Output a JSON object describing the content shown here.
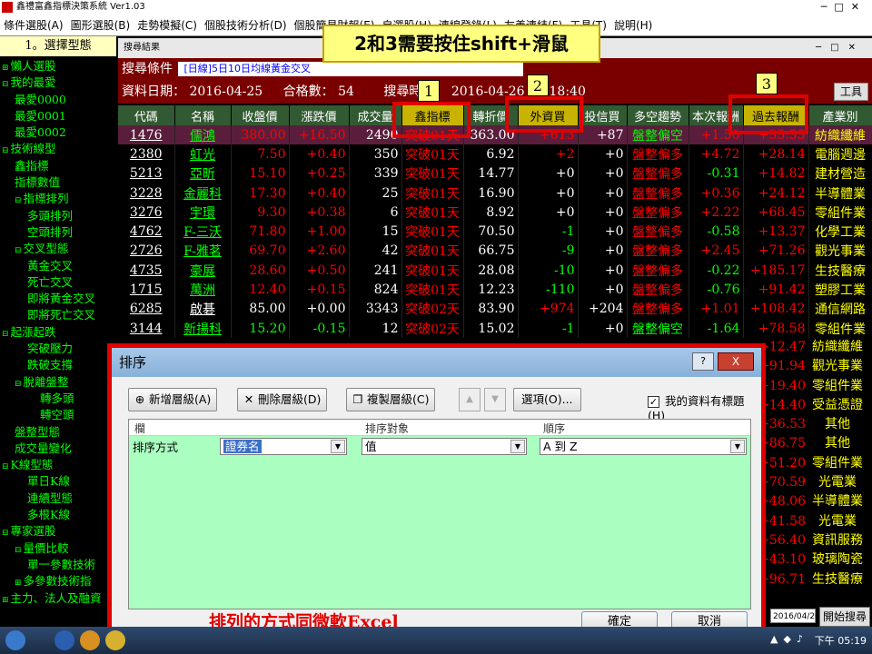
{
  "app": {
    "title": "鑫禮富鑫指標決策系統 Ver1.03",
    "inner_window_title": "搜尋結果"
  },
  "menu": [
    "條件選股(A)",
    "圖形選股(B)",
    "走勢模擬(C)",
    "個股技術分析(D)",
    "個股簡易財報(E)",
    "自選股(H)",
    "連線登錄(L)",
    "友善連結(F)",
    "工具(T)",
    "說明(H)"
  ],
  "sidebar": {
    "header": "1。選擇型態",
    "items": [
      {
        "level": 0,
        "label": "懶人選股",
        "toggle": "⊞"
      },
      {
        "level": 0,
        "label": "我的最愛",
        "toggle": "⊟"
      },
      {
        "level": 1,
        "label": "最愛0000",
        "toggle": ""
      },
      {
        "level": 1,
        "label": "最愛0001",
        "toggle": ""
      },
      {
        "level": 1,
        "label": "最愛0002",
        "toggle": ""
      },
      {
        "level": 0,
        "label": "技術線型",
        "toggle": "⊟"
      },
      {
        "level": 1,
        "label": "鑫指標",
        "toggle": ""
      },
      {
        "level": 1,
        "label": "指標數值",
        "toggle": ""
      },
      {
        "level": 1,
        "label": "指標排列",
        "toggle": "⊟"
      },
      {
        "level": 2,
        "label": "多頭排列",
        "toggle": ""
      },
      {
        "level": 2,
        "label": "空頭排列",
        "toggle": ""
      },
      {
        "level": 1,
        "label": "交叉型態",
        "toggle": "⊟"
      },
      {
        "level": 2,
        "label": "黃金交叉",
        "toggle": ""
      },
      {
        "level": 2,
        "label": "死亡交叉",
        "toggle": ""
      },
      {
        "level": 2,
        "label": "即將黃金交叉",
        "toggle": ""
      },
      {
        "level": 2,
        "label": "即將死亡交叉",
        "toggle": ""
      },
      {
        "level": 0,
        "label": "起漲起跌",
        "toggle": "⊟"
      },
      {
        "level": 2,
        "label": "突破壓力",
        "toggle": ""
      },
      {
        "level": 2,
        "label": "跌破支撐",
        "toggle": ""
      },
      {
        "level": 1,
        "label": "脫離盤整",
        "toggle": "⊟"
      },
      {
        "level": 3,
        "label": "轉多頭",
        "toggle": ""
      },
      {
        "level": 3,
        "label": "轉空頭",
        "toggle": ""
      },
      {
        "level": 1,
        "label": "盤整型態",
        "toggle": ""
      },
      {
        "level": 1,
        "label": "成交量變化",
        "toggle": ""
      },
      {
        "level": 0,
        "label": "K線型態",
        "toggle": "⊟"
      },
      {
        "level": 2,
        "label": "單日K線",
        "toggle": ""
      },
      {
        "level": 2,
        "label": "連續型態",
        "toggle": ""
      },
      {
        "level": 2,
        "label": "多根K線",
        "toggle": ""
      },
      {
        "level": 0,
        "label": "專家選股",
        "toggle": "⊟"
      },
      {
        "level": 1,
        "label": "量價比較",
        "toggle": "⊟"
      },
      {
        "level": 2,
        "label": "單一參數技術",
        "toggle": ""
      },
      {
        "level": 1,
        "label": "多參數技術指",
        "toggle": "⊞"
      },
      {
        "level": 0,
        "label": "主力、法人及融資",
        "toggle": "⊞"
      }
    ]
  },
  "search": {
    "label": "搜尋條件",
    "condition": "[日線]5日10日均線黃金交叉",
    "date_label": "資料日期：",
    "date_value": "2016-04-25",
    "count_label": "合格數：",
    "count_value": "54",
    "time_label": "搜尋時間：",
    "time_value": "2016-04-26 17:18:40",
    "tools": "工具"
  },
  "table": {
    "headers": [
      "代碼",
      "名稱",
      "收盤價",
      "漲跌價",
      "成交量",
      "鑫指標",
      "轉折價",
      "外資買",
      "投信買",
      "多空趨勢",
      "本次報酬",
      "過去報酬",
      "產業別"
    ],
    "rows": [
      [
        "1476",
        "儒鴻",
        "380.00",
        "+16.50",
        "2490",
        "突破01天",
        "363.00",
        "+613",
        "+87",
        "盤整偏空",
        "+1.50",
        "+35.55",
        "紡織纖維"
      ],
      [
        "2380",
        "虹光",
        "7.50",
        "+0.40",
        "350",
        "突破01天",
        "6.92",
        "+2",
        "+0",
        "盤整偏多",
        "+4.72",
        "+28.14",
        "電腦週邊"
      ],
      [
        "5213",
        "亞昕",
        "15.10",
        "+0.25",
        "339",
        "突破01天",
        "14.77",
        "+0",
        "+0",
        "盤整偏多",
        "-0.31",
        "+14.82",
        "建材營造"
      ],
      [
        "3228",
        "金麗科",
        "17.30",
        "+0.40",
        "25",
        "突破01天",
        "16.90",
        "+0",
        "+0",
        "盤整偏多",
        "+0.36",
        "+24.12",
        "半導體業"
      ],
      [
        "3276",
        "宇環",
        "9.30",
        "+0.38",
        "6",
        "突破01天",
        "8.92",
        "+0",
        "+0",
        "盤整偏多",
        "+2.22",
        "+68.45",
        "零組件業"
      ],
      [
        "4762",
        "F-三沃",
        "71.80",
        "+1.00",
        "15",
        "突破01天",
        "70.50",
        "-1",
        "+0",
        "盤整偏多",
        "-0.58",
        "+13.37",
        "化學工業"
      ],
      [
        "2726",
        "F-雅茗",
        "69.70",
        "+2.60",
        "42",
        "突破01天",
        "66.75",
        "-9",
        "+0",
        "盤整偏多",
        "+2.45",
        "+71.26",
        "觀光事業"
      ],
      [
        "4735",
        "豪展",
        "28.60",
        "+0.50",
        "241",
        "突破01天",
        "28.08",
        "-10",
        "+0",
        "盤整偏多",
        "-0.22",
        "+185.17",
        "生技醫療"
      ],
      [
        "1715",
        "萬洲",
        "12.40",
        "+0.15",
        "824",
        "突破01天",
        "12.23",
        "-110",
        "+0",
        "盤整偏多",
        "-0.76",
        "+91.42",
        "塑膠工業"
      ],
      [
        "6285",
        "啟碁",
        "85.00",
        "+0.00",
        "3343",
        "突破02天",
        "83.90",
        "+974",
        "+204",
        "盤整偏多",
        "+1.01",
        "+108.42",
        "通信網路"
      ],
      [
        "3144",
        "新揚科",
        "15.20",
        "-0.15",
        "12",
        "突破02天",
        "15.02",
        "-1",
        "+0",
        "盤整偏空",
        "-1.64",
        "+78.58",
        "零組件業"
      ]
    ],
    "hidden_tail": [
      [
        "+12.47",
        "紡織纖維"
      ],
      [
        "+91.94",
        "觀光事業"
      ],
      [
        "+19.40",
        "零組件業"
      ],
      [
        "+14.40",
        "受益憑證"
      ],
      [
        "+36.53",
        "其他"
      ],
      [
        "+86.75",
        "其他"
      ],
      [
        "+51.20",
        "零組件業"
      ],
      [
        "+70.59",
        "光電業"
      ],
      [
        "+48.06",
        "半導體業"
      ],
      [
        "+41.58",
        "光電業"
      ],
      [
        "+56.40",
        "資訊服務"
      ],
      [
        "+43.10",
        "玻璃陶瓷"
      ],
      [
        "+96.71",
        "生技醫療"
      ]
    ]
  },
  "callout": "2和3需要按住shift+滑鼠",
  "tags": [
    "1",
    "2",
    "3"
  ],
  "dialog": {
    "title": "排序",
    "help": "?",
    "close": "X",
    "add_level": "新增層級(A)",
    "delete_level": "刪除層級(D)",
    "copy_level": "複製層級(C)",
    "options": "選項(O)...",
    "has_header_check": "✓",
    "has_header": "我的資料有標題(H)",
    "col_header_column": "欄",
    "col_header_sorton": "排序對象",
    "col_header_order": "順序",
    "row_label": "排序方式",
    "column_value": "證券名",
    "sorton_value": "值",
    "order_value": "A 到 Z",
    "note": "排列的方式同微軟Excel",
    "ok": "確定",
    "cancel": "取消"
  },
  "bottom": {
    "date": "2016/04/26",
    "start_search": "開始搜尋"
  },
  "taskbar": {
    "clock": "下午 05:19"
  },
  "colors": {
    "up": "#ff0000",
    "down": "#00ff00",
    "header_bg": "#325a32",
    "highlight_header": "#c8b400",
    "frame_red": "#e00000"
  }
}
